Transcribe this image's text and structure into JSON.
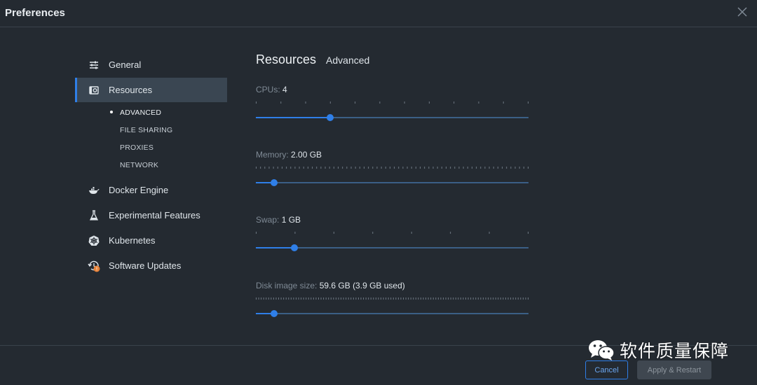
{
  "window": {
    "title": "Preferences"
  },
  "sidebar": {
    "items": [
      {
        "label": "General",
        "icon": "sliders-icon"
      },
      {
        "label": "Resources",
        "icon": "resources-icon",
        "active": true
      },
      {
        "label": "Docker Engine",
        "icon": "whale-icon"
      },
      {
        "label": "Experimental Features",
        "icon": "flask-icon"
      },
      {
        "label": "Kubernetes",
        "icon": "kubernetes-icon"
      },
      {
        "label": "Software Updates",
        "icon": "updates-icon",
        "badge": "!"
      }
    ],
    "sub_items": [
      {
        "label": "ADVANCED",
        "active": true
      },
      {
        "label": "FILE SHARING"
      },
      {
        "label": "PROXIES"
      },
      {
        "label": "NETWORK"
      }
    ]
  },
  "main": {
    "title": "Resources",
    "subtitle": "Advanced",
    "settings": [
      {
        "label": "CPUs:",
        "value": "4",
        "position": 0.273,
        "ticks": 12
      },
      {
        "label": "Memory:",
        "value": "2.00 GB",
        "position": 0.066,
        "ticks": 64
      },
      {
        "label": "Swap:",
        "value": "1 GB",
        "position": 0.142,
        "ticks": 8
      },
      {
        "label": "Disk image size:",
        "value": "59.6 GB (3.9 GB used)",
        "position": 0.067,
        "ticks": 110
      }
    ]
  },
  "footer": {
    "cancel_label": "Cancel",
    "apply_label": "Apply & Restart"
  },
  "watermark": {
    "text": "软件质量保障"
  },
  "colors": {
    "accent": "#2f7fe8",
    "background": "#242a31",
    "sidebar_active": "#3a4652",
    "badge": "#e8833a"
  }
}
